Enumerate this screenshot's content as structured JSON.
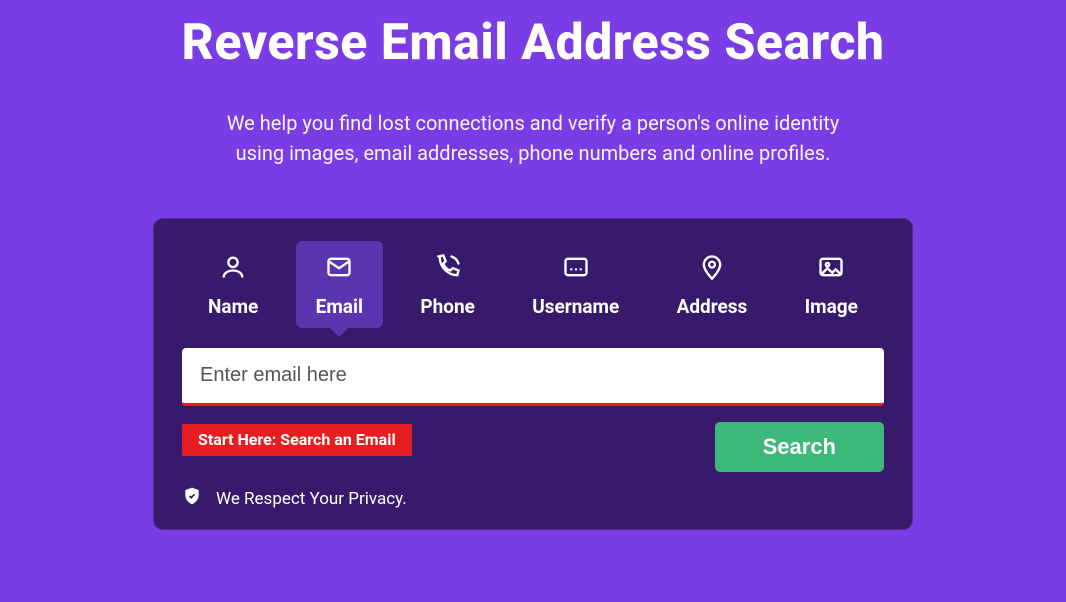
{
  "header": {
    "title": "Reverse Email Address Search",
    "subtitle": "We help you find lost connections and verify a person's online identity using images, email addresses, phone numbers and online profiles."
  },
  "tabs": {
    "items": [
      {
        "label": "Name",
        "icon": "person-icon",
        "active": false
      },
      {
        "label": "Email",
        "icon": "email-icon",
        "active": true
      },
      {
        "label": "Phone",
        "icon": "phone-icon",
        "active": false
      },
      {
        "label": "Username",
        "icon": "username-icon",
        "active": false
      },
      {
        "label": "Address",
        "icon": "address-icon",
        "active": false
      },
      {
        "label": "Image",
        "icon": "image-icon",
        "active": false
      }
    ]
  },
  "search": {
    "placeholder": "Enter email here",
    "value": "",
    "hint": "Start Here: Search an Email",
    "button": "Search"
  },
  "privacy": {
    "text": "We Respect Your Privacy."
  },
  "colors": {
    "page_bg": "#7a3ce5",
    "panel_bg": "#371a6b",
    "tab_active_bg": "#5b35b0",
    "accent_red": "#e61e22",
    "button_green": "#3cb878"
  }
}
